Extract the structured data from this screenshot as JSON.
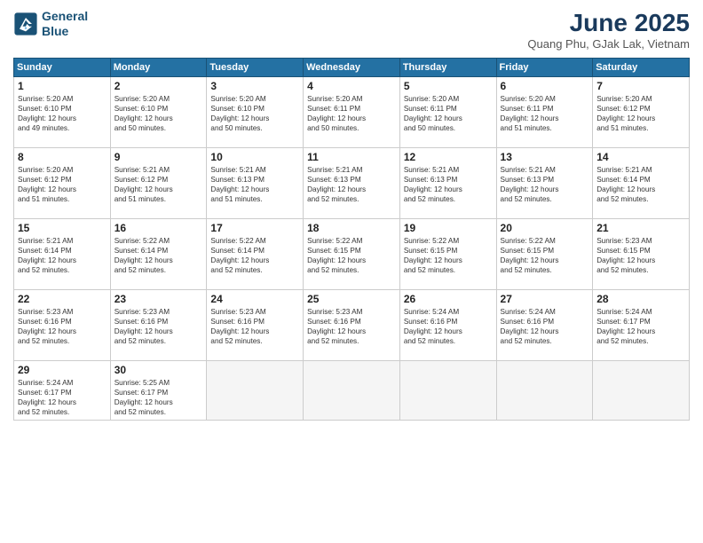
{
  "header": {
    "logo_line1": "General",
    "logo_line2": "Blue",
    "month": "June 2025",
    "location": "Quang Phu, GJak Lak, Vietnam"
  },
  "days_of_week": [
    "Sunday",
    "Monday",
    "Tuesday",
    "Wednesday",
    "Thursday",
    "Friday",
    "Saturday"
  ],
  "weeks": [
    [
      {
        "day": "1",
        "info": "Sunrise: 5:20 AM\nSunset: 6:10 PM\nDaylight: 12 hours\nand 49 minutes."
      },
      {
        "day": "2",
        "info": "Sunrise: 5:20 AM\nSunset: 6:10 PM\nDaylight: 12 hours\nand 50 minutes."
      },
      {
        "day": "3",
        "info": "Sunrise: 5:20 AM\nSunset: 6:10 PM\nDaylight: 12 hours\nand 50 minutes."
      },
      {
        "day": "4",
        "info": "Sunrise: 5:20 AM\nSunset: 6:11 PM\nDaylight: 12 hours\nand 50 minutes."
      },
      {
        "day": "5",
        "info": "Sunrise: 5:20 AM\nSunset: 6:11 PM\nDaylight: 12 hours\nand 50 minutes."
      },
      {
        "day": "6",
        "info": "Sunrise: 5:20 AM\nSunset: 6:11 PM\nDaylight: 12 hours\nand 51 minutes."
      },
      {
        "day": "7",
        "info": "Sunrise: 5:20 AM\nSunset: 6:12 PM\nDaylight: 12 hours\nand 51 minutes."
      }
    ],
    [
      {
        "day": "8",
        "info": "Sunrise: 5:20 AM\nSunset: 6:12 PM\nDaylight: 12 hours\nand 51 minutes."
      },
      {
        "day": "9",
        "info": "Sunrise: 5:21 AM\nSunset: 6:12 PM\nDaylight: 12 hours\nand 51 minutes."
      },
      {
        "day": "10",
        "info": "Sunrise: 5:21 AM\nSunset: 6:13 PM\nDaylight: 12 hours\nand 51 minutes."
      },
      {
        "day": "11",
        "info": "Sunrise: 5:21 AM\nSunset: 6:13 PM\nDaylight: 12 hours\nand 52 minutes."
      },
      {
        "day": "12",
        "info": "Sunrise: 5:21 AM\nSunset: 6:13 PM\nDaylight: 12 hours\nand 52 minutes."
      },
      {
        "day": "13",
        "info": "Sunrise: 5:21 AM\nSunset: 6:13 PM\nDaylight: 12 hours\nand 52 minutes."
      },
      {
        "day": "14",
        "info": "Sunrise: 5:21 AM\nSunset: 6:14 PM\nDaylight: 12 hours\nand 52 minutes."
      }
    ],
    [
      {
        "day": "15",
        "info": "Sunrise: 5:21 AM\nSunset: 6:14 PM\nDaylight: 12 hours\nand 52 minutes."
      },
      {
        "day": "16",
        "info": "Sunrise: 5:22 AM\nSunset: 6:14 PM\nDaylight: 12 hours\nand 52 minutes."
      },
      {
        "day": "17",
        "info": "Sunrise: 5:22 AM\nSunset: 6:14 PM\nDaylight: 12 hours\nand 52 minutes."
      },
      {
        "day": "18",
        "info": "Sunrise: 5:22 AM\nSunset: 6:15 PM\nDaylight: 12 hours\nand 52 minutes."
      },
      {
        "day": "19",
        "info": "Sunrise: 5:22 AM\nSunset: 6:15 PM\nDaylight: 12 hours\nand 52 minutes."
      },
      {
        "day": "20",
        "info": "Sunrise: 5:22 AM\nSunset: 6:15 PM\nDaylight: 12 hours\nand 52 minutes."
      },
      {
        "day": "21",
        "info": "Sunrise: 5:23 AM\nSunset: 6:15 PM\nDaylight: 12 hours\nand 52 minutes."
      }
    ],
    [
      {
        "day": "22",
        "info": "Sunrise: 5:23 AM\nSunset: 6:16 PM\nDaylight: 12 hours\nand 52 minutes."
      },
      {
        "day": "23",
        "info": "Sunrise: 5:23 AM\nSunset: 6:16 PM\nDaylight: 12 hours\nand 52 minutes."
      },
      {
        "day": "24",
        "info": "Sunrise: 5:23 AM\nSunset: 6:16 PM\nDaylight: 12 hours\nand 52 minutes."
      },
      {
        "day": "25",
        "info": "Sunrise: 5:23 AM\nSunset: 6:16 PM\nDaylight: 12 hours\nand 52 minutes."
      },
      {
        "day": "26",
        "info": "Sunrise: 5:24 AM\nSunset: 6:16 PM\nDaylight: 12 hours\nand 52 minutes."
      },
      {
        "day": "27",
        "info": "Sunrise: 5:24 AM\nSunset: 6:16 PM\nDaylight: 12 hours\nand 52 minutes."
      },
      {
        "day": "28",
        "info": "Sunrise: 5:24 AM\nSunset: 6:17 PM\nDaylight: 12 hours\nand 52 minutes."
      }
    ],
    [
      {
        "day": "29",
        "info": "Sunrise: 5:24 AM\nSunset: 6:17 PM\nDaylight: 12 hours\nand 52 minutes."
      },
      {
        "day": "30",
        "info": "Sunrise: 5:25 AM\nSunset: 6:17 PM\nDaylight: 12 hours\nand 52 minutes."
      },
      {
        "day": "",
        "info": ""
      },
      {
        "day": "",
        "info": ""
      },
      {
        "day": "",
        "info": ""
      },
      {
        "day": "",
        "info": ""
      },
      {
        "day": "",
        "info": ""
      }
    ]
  ]
}
